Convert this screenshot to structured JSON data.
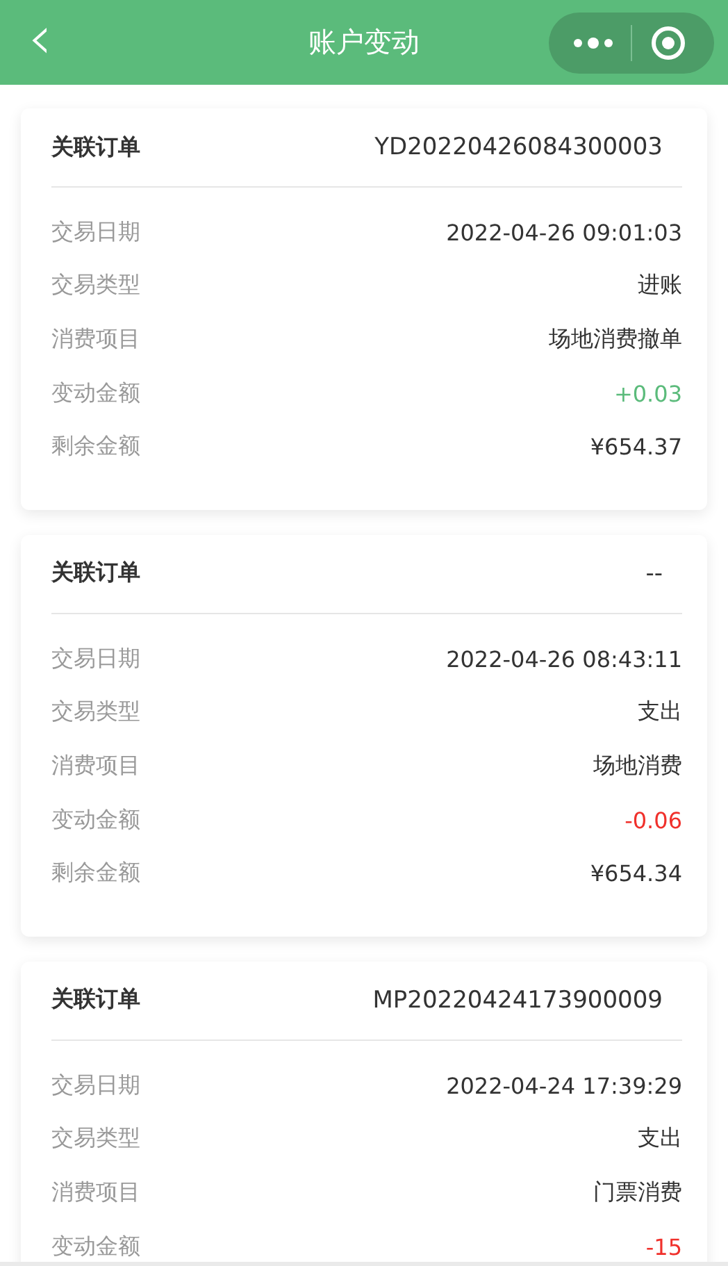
{
  "nav_bar": {
    "back_icon": "‹",
    "title": "账户变动"
  },
  "records": [
    {
      "order_label": "关联订单",
      "order_no": "YD20220426084300003",
      "rows": [
        {
          "label": "交易日期",
          "value": "2022-04-26 09:01:03",
          "kind": "plain"
        },
        {
          "label": "交易类型",
          "value": "进账",
          "kind": "plain"
        },
        {
          "label": "消费项目",
          "value": "场地消费撤单",
          "kind": "plain"
        },
        {
          "label": "变动金额",
          "value": "+0.03",
          "kind": "credit"
        },
        {
          "label": "剩余金额",
          "value": "¥654.37",
          "kind": "plain"
        }
      ]
    },
    {
      "order_label": "关联订单",
      "order_no": "--",
      "rows": [
        {
          "label": "交易日期",
          "value": "2022-04-26 08:43:11",
          "kind": "plain"
        },
        {
          "label": "交易类型",
          "value": "支出",
          "kind": "plain"
        },
        {
          "label": "消费项目",
          "value": "场地消费",
          "kind": "plain"
        },
        {
          "label": "变动金额",
          "value": "-0.06",
          "kind": "debit"
        },
        {
          "label": "剩余金额",
          "value": "¥654.34",
          "kind": "plain"
        }
      ]
    },
    {
      "order_label": "关联订单",
      "order_no": "MP20220424173900009",
      "rows": [
        {
          "label": "交易日期",
          "value": "2022-04-24 17:39:29",
          "kind": "plain"
        },
        {
          "label": "交易类型",
          "value": "支出",
          "kind": "plain"
        },
        {
          "label": "消费项目",
          "value": "门票消费",
          "kind": "plain"
        },
        {
          "label": "变动金额",
          "value": "-15",
          "kind": "debit"
        }
      ]
    }
  ]
}
